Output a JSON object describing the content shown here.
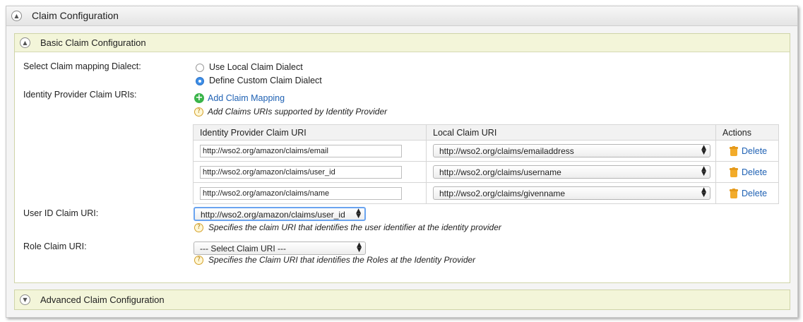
{
  "panel": {
    "title": "Claim Configuration"
  },
  "basic": {
    "title": "Basic Claim Configuration",
    "dialect_label": "Select Claim mapping Dialect:",
    "dialect_options": [
      "Use Local Claim Dialect",
      "Define Custom Claim Dialect"
    ],
    "dialect_selected": "Define Custom Claim Dialect",
    "idp_uris_label": "Identity Provider Claim URIs:",
    "add_mapping": "Add Claim Mapping",
    "add_hint": "Add Claims URIs supported by Identity Provider",
    "table": {
      "headers": [
        "Identity Provider Claim URI",
        "Local Claim URI",
        "Actions"
      ],
      "rows": [
        {
          "idp": "http://wso2.org/amazon/claims/email",
          "local": "http://wso2.org/claims/emailaddress",
          "action": "Delete"
        },
        {
          "idp": "http://wso2.org/amazon/claims/user_id",
          "local": "http://wso2.org/claims/username",
          "action": "Delete"
        },
        {
          "idp": "http://wso2.org/amazon/claims/name",
          "local": "http://wso2.org/claims/givenname",
          "action": "Delete"
        }
      ]
    },
    "user_id_label": "User ID Claim URI:",
    "user_id_value": "http://wso2.org/amazon/claims/user_id",
    "user_id_hint": "Specifies the claim URI that identifies the user identifier at the identity provider",
    "role_label": "Role Claim URI:",
    "role_value": "--- Select Claim URI ---",
    "role_hint": "Specifies the Claim URI that identifies the Roles at the Identity Provider"
  },
  "advanced": {
    "title": "Advanced Claim Configuration"
  },
  "icons": {
    "collapse": "chevron-up-icon",
    "expand": "chevron-down-icon",
    "add": "plus-circle-icon",
    "help": "help-icon",
    "delete": "trash-icon",
    "select_arrows": "updown-arrow-icon"
  },
  "colors": {
    "link": "#2062b4",
    "section_header": "#f3f5d9",
    "radio_selected": "#3d8fe8",
    "add_icon": "#3ab44a",
    "trash": "#f2ab2a"
  }
}
